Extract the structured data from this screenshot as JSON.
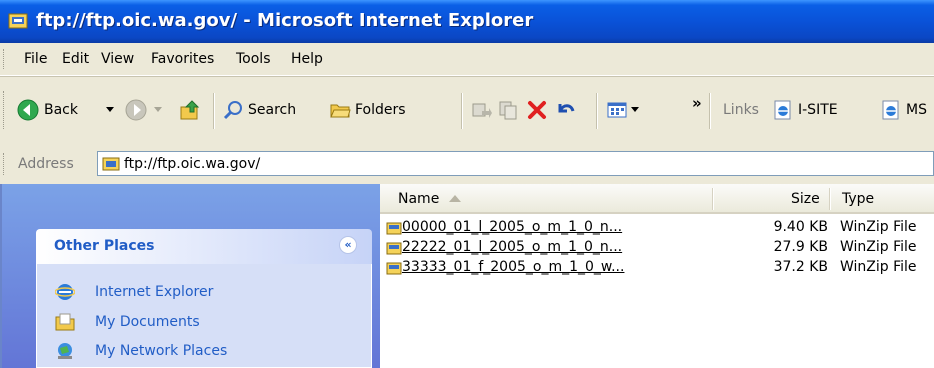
{
  "window": {
    "title": "ftp://ftp.oic.wa.gov/ - Microsoft Internet Explorer"
  },
  "menu": [
    "File",
    "Edit",
    "View",
    "Favorites",
    "Tools",
    "Help"
  ],
  "toolbar": {
    "back_label": "Back",
    "search_label": "Search",
    "folders_label": "Folders",
    "overflow": "»",
    "links_label": "Links",
    "link_isite": "I-SITE",
    "link_ms": "MS"
  },
  "address": {
    "label": "Address",
    "value": "ftp://ftp.oic.wa.gov/"
  },
  "sidebar": {
    "panel_title": "Other Places",
    "collapse_glyph": "«",
    "items": [
      {
        "label": "Internet Explorer",
        "icon": "internet-explorer-icon"
      },
      {
        "label": "My Documents",
        "icon": "my-documents-icon"
      },
      {
        "label": "My Network Places",
        "icon": "network-places-icon"
      }
    ]
  },
  "filelist": {
    "columns": {
      "name": "Name",
      "size": "Size",
      "type": "Type"
    },
    "rows": [
      {
        "name": "00000_01_l_2005_o_m_1_0_n...",
        "size": "9.40 KB",
        "type": "WinZip File"
      },
      {
        "name": "22222_01_l_2005_o_m_1_0_n...",
        "size": "27.9 KB",
        "type": "WinZip File"
      },
      {
        "name": "33333_01_f_2005_o_m_1_0_w...",
        "size": "37.2 KB",
        "type": "WinZip File"
      }
    ]
  },
  "colors": {
    "title_bar": "#0a52d8",
    "panel_title": "#215dc6",
    "sidebar_bg": "#7ba2e7",
    "chrome_bg": "#ece9d8"
  }
}
